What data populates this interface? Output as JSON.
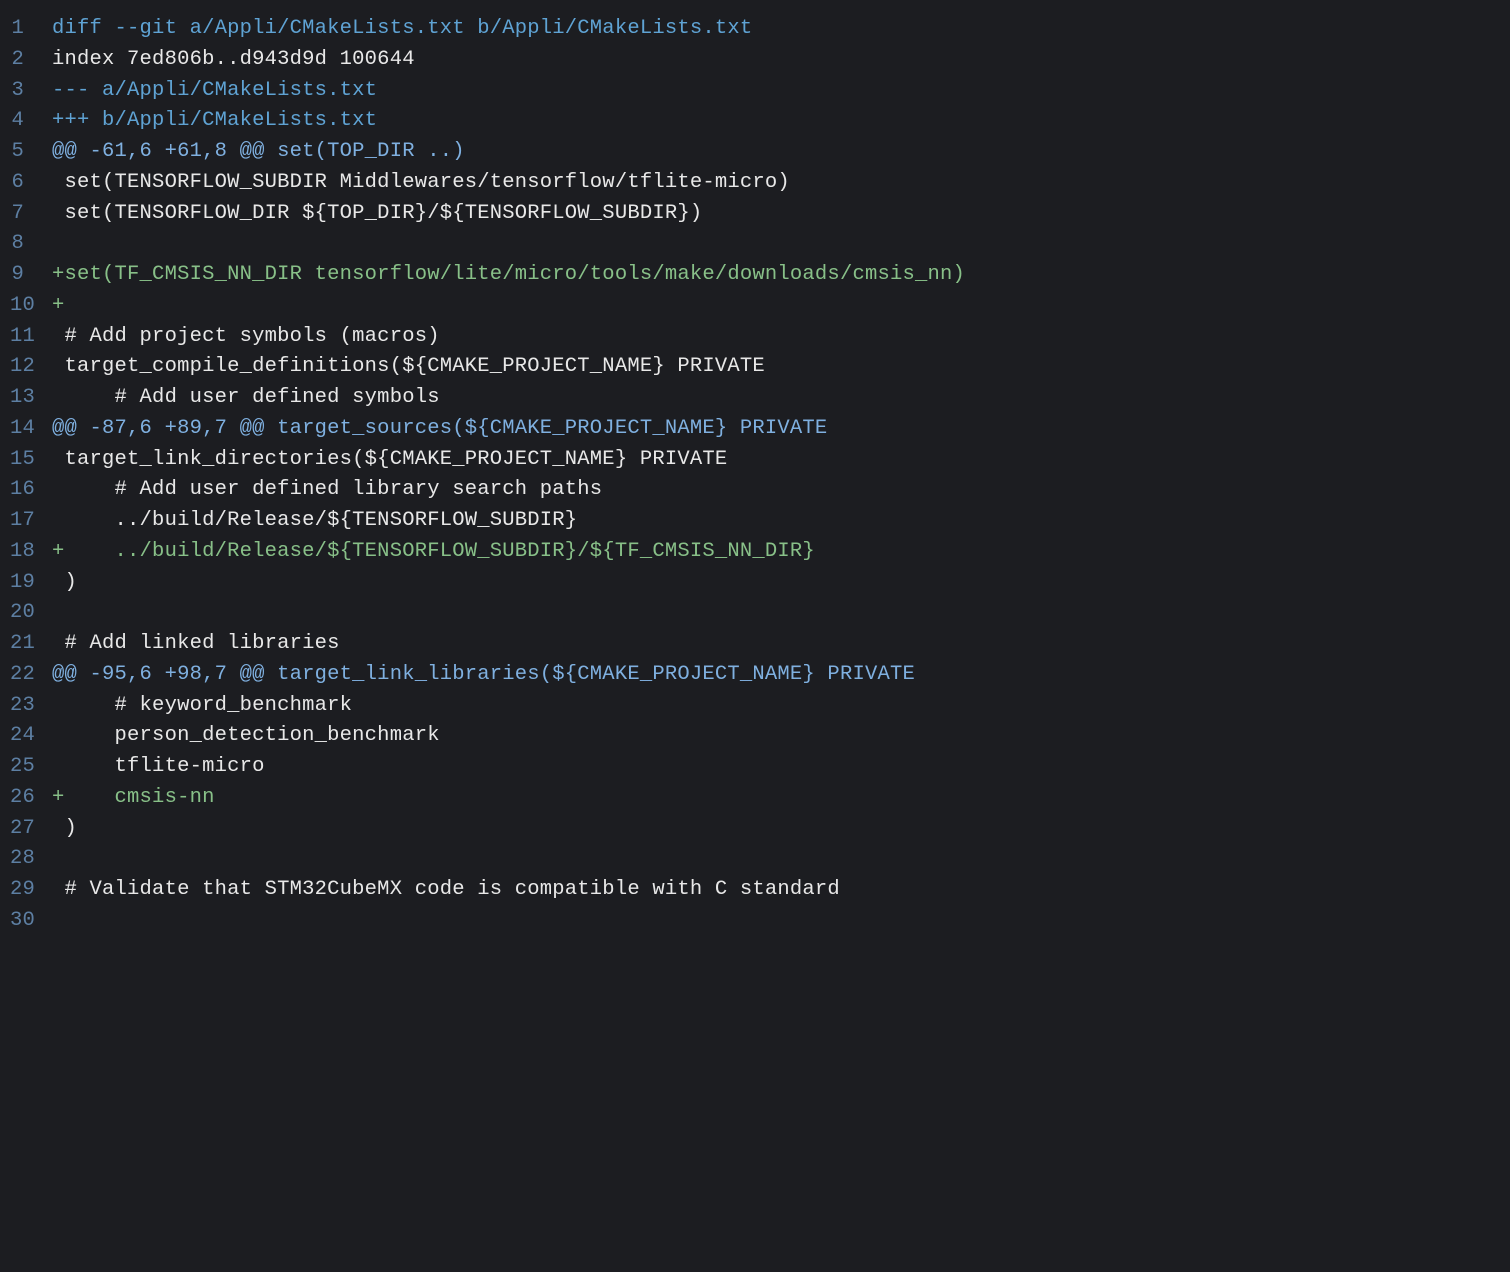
{
  "code": {
    "lines": [
      {
        "num": "1",
        "type": "header",
        "text": "diff --git a/Appli/CMakeLists.txt b/Appli/CMakeLists.txt"
      },
      {
        "num": "2",
        "type": "context",
        "text": "index 7ed806b..d943d9d 100644"
      },
      {
        "num": "3",
        "type": "header",
        "text": "--- a/Appli/CMakeLists.txt"
      },
      {
        "num": "4",
        "type": "header",
        "text": "+++ b/Appli/CMakeLists.txt"
      },
      {
        "num": "5",
        "type": "hunk",
        "text": "@@ -61,6 +61,8 @@ set(TOP_DIR ..)"
      },
      {
        "num": "6",
        "type": "context",
        "text": " set(TENSORFLOW_SUBDIR Middlewares/tensorflow/tflite-micro)"
      },
      {
        "num": "7",
        "type": "context",
        "text": " set(TENSORFLOW_DIR ${TOP_DIR}/${TENSORFLOW_SUBDIR})"
      },
      {
        "num": "8",
        "type": "context",
        "text": " "
      },
      {
        "num": "9",
        "type": "add",
        "text": "+set(TF_CMSIS_NN_DIR tensorflow/lite/micro/tools/make/downloads/cmsis_nn)"
      },
      {
        "num": "10",
        "type": "add",
        "text": "+"
      },
      {
        "num": "11",
        "type": "context",
        "text": " # Add project symbols (macros)"
      },
      {
        "num": "12",
        "type": "context",
        "text": " target_compile_definitions(${CMAKE_PROJECT_NAME} PRIVATE"
      },
      {
        "num": "13",
        "type": "context",
        "text": "     # Add user defined symbols"
      },
      {
        "num": "14",
        "type": "hunk",
        "text": "@@ -87,6 +89,7 @@ target_sources(${CMAKE_PROJECT_NAME} PRIVATE"
      },
      {
        "num": "15",
        "type": "context",
        "text": " target_link_directories(${CMAKE_PROJECT_NAME} PRIVATE"
      },
      {
        "num": "16",
        "type": "context",
        "text": "     # Add user defined library search paths"
      },
      {
        "num": "17",
        "type": "context",
        "text": "     ../build/Release/${TENSORFLOW_SUBDIR}"
      },
      {
        "num": "18",
        "type": "add",
        "text": "+    ../build/Release/${TENSORFLOW_SUBDIR}/${TF_CMSIS_NN_DIR}"
      },
      {
        "num": "19",
        "type": "context",
        "text": " )"
      },
      {
        "num": "20",
        "type": "context",
        "text": " "
      },
      {
        "num": "21",
        "type": "context",
        "text": " # Add linked libraries"
      },
      {
        "num": "22",
        "type": "hunk",
        "text": "@@ -95,6 +98,7 @@ target_link_libraries(${CMAKE_PROJECT_NAME} PRIVATE"
      },
      {
        "num": "23",
        "type": "context",
        "text": "     # keyword_benchmark"
      },
      {
        "num": "24",
        "type": "context",
        "text": "     person_detection_benchmark"
      },
      {
        "num": "25",
        "type": "context",
        "text": "     tflite-micro"
      },
      {
        "num": "26",
        "type": "add",
        "text": "+    cmsis-nn"
      },
      {
        "num": "27",
        "type": "context",
        "text": " )"
      },
      {
        "num": "28",
        "type": "context",
        "text": " "
      },
      {
        "num": "29",
        "type": "context",
        "text": " # Validate that STM32CubeMX code is compatible with C standard"
      },
      {
        "num": "30",
        "type": "context",
        "text": ""
      }
    ]
  }
}
